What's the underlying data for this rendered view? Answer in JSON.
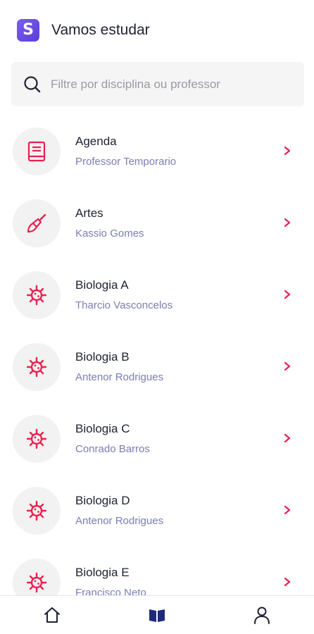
{
  "header": {
    "logo_letter": "S",
    "title": "Vamos estudar"
  },
  "search": {
    "placeholder": "Filtre por disciplina ou professor",
    "value": ""
  },
  "subjects": [
    {
      "title": "Agenda",
      "teacher": "Professor Temporario",
      "icon": "book-icon"
    },
    {
      "title": "Artes",
      "teacher": "Kassio Gomes",
      "icon": "paintbrush-icon"
    },
    {
      "title": "Biologia A",
      "teacher": "Tharcio Vasconcelos",
      "icon": "virus-icon"
    },
    {
      "title": "Biologia B",
      "teacher": "Antenor Rodrigues",
      "icon": "virus-icon"
    },
    {
      "title": "Biologia C",
      "teacher": "Conrado Barros",
      "icon": "virus-icon"
    },
    {
      "title": "Biologia D",
      "teacher": "Antenor Rodrigues",
      "icon": "virus-icon"
    },
    {
      "title": "Biologia E",
      "teacher": "Francisco Neto",
      "icon": "virus-icon"
    }
  ],
  "nav": [
    {
      "name": "home",
      "icon": "home-icon",
      "active": false
    },
    {
      "name": "subjects",
      "icon": "open-book-icon",
      "active": true
    },
    {
      "name": "profile",
      "icon": "user-icon",
      "active": false
    }
  ],
  "colors": {
    "accent": "#e8224f",
    "subtitle": "#7b7db4",
    "nav_active": "#1e2a7a",
    "logo": "#6a4ee6"
  }
}
